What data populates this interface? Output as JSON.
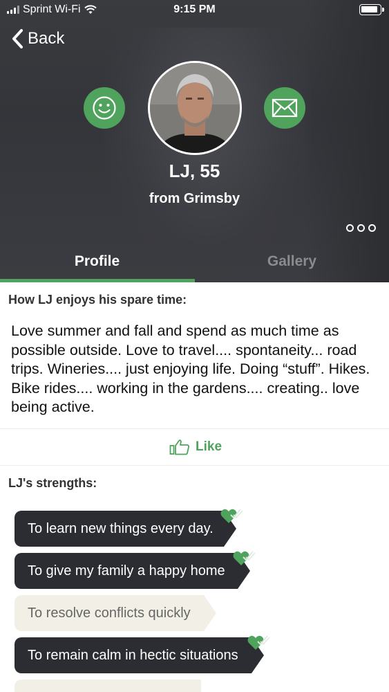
{
  "status_bar": {
    "carrier": "Sprint Wi-Fi",
    "time": "9:15 PM"
  },
  "nav": {
    "back_label": "Back"
  },
  "profile": {
    "name_age": "LJ, 55",
    "location": "from Grimsby"
  },
  "tabs": [
    {
      "label": "Profile",
      "active": true
    },
    {
      "label": "Gallery",
      "active": false
    }
  ],
  "spare_time": {
    "heading": "How LJ enjoys his spare time:",
    "text": "Love summer and fall and spend as much time as possible outside. Love to travel.... spontaneity... road trips. Wineries.... just enjoying life.  Doing “stuff”. Hikes. Bike rides.... working in the gardens.... creating.. love being active."
  },
  "like": {
    "label": "Like"
  },
  "strengths": {
    "heading": "LJ's strengths:",
    "items": [
      {
        "label": "To learn new things every day.",
        "shared": true
      },
      {
        "label": "To give my family a happy home",
        "shared": true
      },
      {
        "label": "To resolve conflicts quickly",
        "shared": false
      },
      {
        "label": "To remain calm in hectic situations",
        "shared": true
      }
    ]
  },
  "colors": {
    "accent": "#4fa35c",
    "dark_pill": "#2c2d33",
    "light_pill": "#f2f0e6"
  },
  "icons": [
    "signal-icon",
    "wifi-icon",
    "battery-icon",
    "chevron-left-icon",
    "smiley-icon",
    "envelope-icon",
    "more-icon",
    "thumbs-up-icon",
    "heart-check-icon"
  ]
}
